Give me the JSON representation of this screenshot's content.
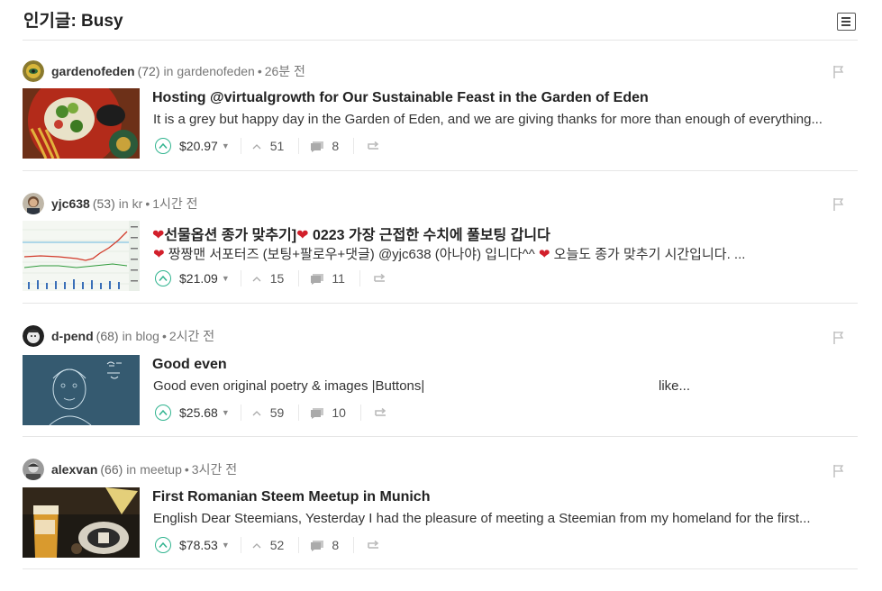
{
  "header": {
    "title": "인기글: Busy",
    "toggle_icon": "list-view-icon"
  },
  "posts": [
    {
      "author": "gardenofeden",
      "reputation": "(72)",
      "in_label": "in",
      "category": "gardenofeden",
      "separator": "•",
      "time": "26분 전",
      "title": "Hosting @virtualgrowth for Our Sustainable Feast in the Garden of Eden",
      "body": "It is a grey but happy day in the Garden of Eden, and we are giving thanks for more than enough of everything...",
      "payout": "$20.97",
      "votes": "51",
      "comments": "8"
    },
    {
      "author": "yjc638",
      "reputation": "(53)",
      "in_label": "in",
      "category": "kr",
      "separator": "•",
      "time": "1시간 전",
      "title_parts": [
        "❤",
        "선물옵션 종가 맞추기]",
        "❤",
        " 0223 가장 근접한 수치에 풀보팅 갑니다"
      ],
      "body_parts": [
        "❤",
        " 짱짱맨 서포터즈 (보팅+팔로우+댓글) @yjc638 (아나야) 입니다^^ ",
        "❤",
        " 오늘도 종가 맞추기 시간입니다. ..."
      ],
      "payout": "$21.09",
      "votes": "15",
      "comments": "11"
    },
    {
      "author": "d-pend",
      "reputation": "(68)",
      "in_label": "in",
      "category": "blog",
      "separator": "•",
      "time": "2시간 전",
      "title": "Good even",
      "body": "Good even original poetry & images |Buttons|",
      "body_tail": "like...",
      "payout": "$25.68",
      "votes": "59",
      "comments": "10"
    },
    {
      "author": "alexvan",
      "reputation": "(66)",
      "in_label": "in",
      "category": "meetup",
      "separator": "•",
      "time": "3시간 전",
      "title": "First Romanian Steem Meetup in Munich",
      "body": "English Dear Steemians, Yesterday I had the pleasure of meeting a Steemian from my homeland for the first...",
      "payout": "$78.53",
      "votes": "52",
      "comments": "8"
    }
  ],
  "colors": {
    "upvote": "#31b48f",
    "heart": "#d21f2b",
    "divider": "#e6e6e6"
  }
}
